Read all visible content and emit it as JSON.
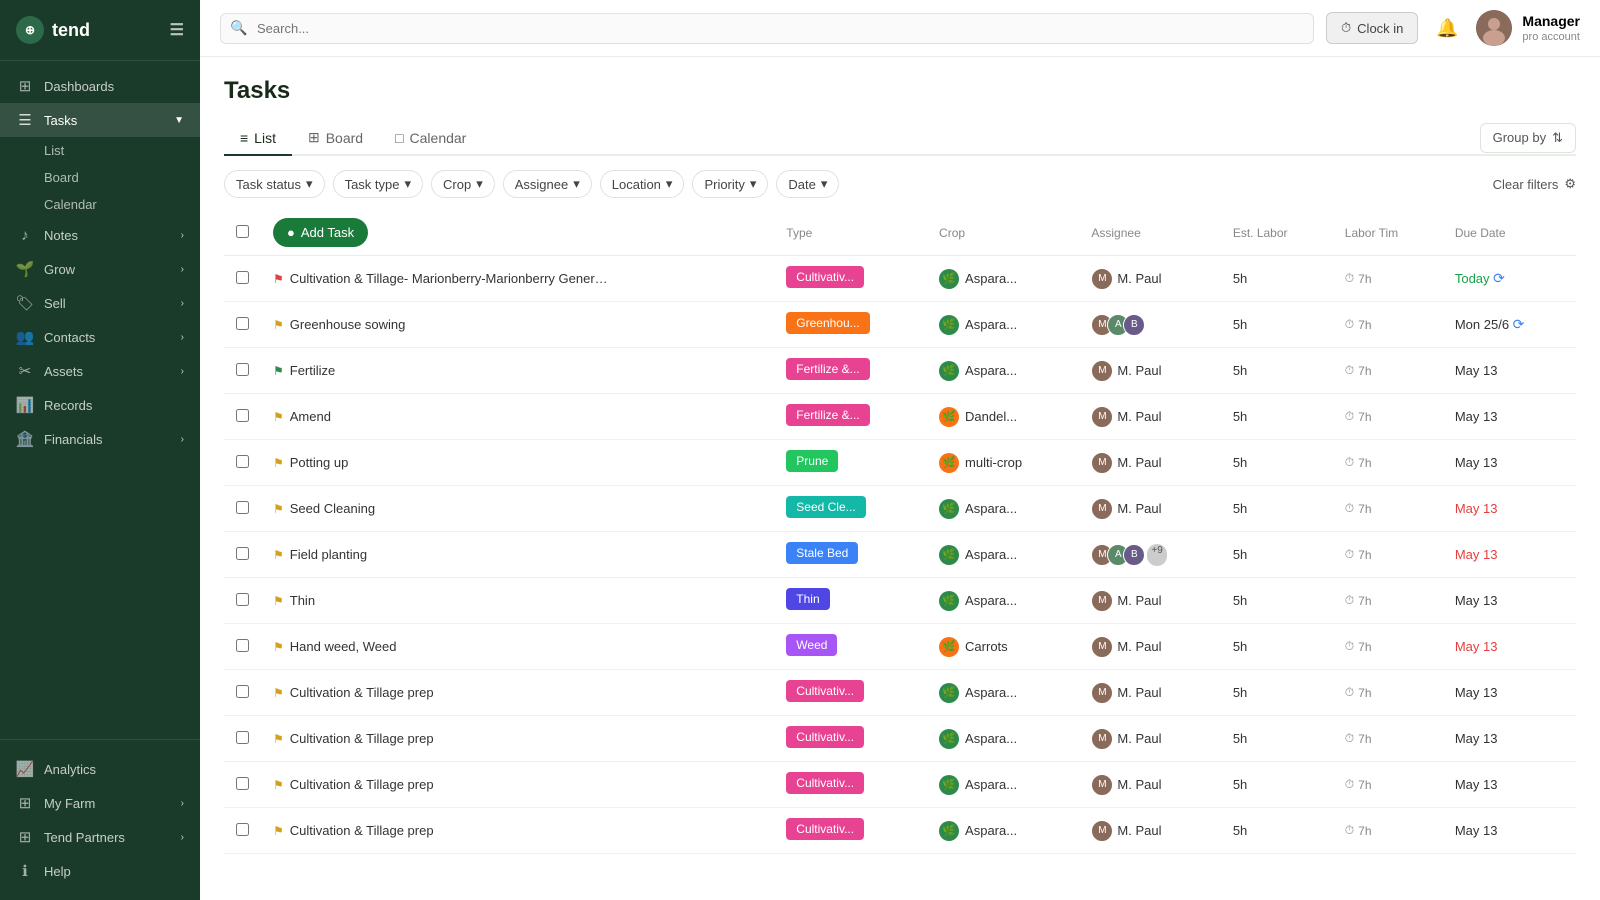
{
  "sidebar": {
    "logo_text": "tend",
    "nav_items": [
      {
        "id": "dashboards",
        "label": "Dashboards",
        "icon": "⊞",
        "active": false
      },
      {
        "id": "tasks",
        "label": "Tasks",
        "icon": "☰",
        "active": true,
        "expanded": true
      },
      {
        "id": "notes",
        "label": "Notes",
        "icon": "♪",
        "active": false,
        "has_arrow": true
      },
      {
        "id": "grow",
        "label": "Grow",
        "icon": "🌱",
        "active": false,
        "has_arrow": true
      },
      {
        "id": "sell",
        "label": "Sell",
        "icon": "🏷",
        "active": false,
        "has_arrow": true
      },
      {
        "id": "contacts",
        "label": "Contacts",
        "icon": "👥",
        "active": false,
        "has_arrow": true
      },
      {
        "id": "assets",
        "label": "Assets",
        "icon": "✂",
        "active": false,
        "has_arrow": true
      },
      {
        "id": "records",
        "label": "Records",
        "icon": "📊",
        "active": false
      },
      {
        "id": "financials",
        "label": "Financials",
        "icon": "🏦",
        "active": false,
        "has_arrow": true
      }
    ],
    "sub_nav": [
      "List",
      "Board",
      "Calendar"
    ],
    "bottom_items": [
      {
        "id": "analytics",
        "label": "Analytics",
        "icon": "📈"
      },
      {
        "id": "my-farm",
        "label": "My Farm",
        "icon": "⊞",
        "has_arrow": true
      },
      {
        "id": "tend-partners",
        "label": "Tend Partners",
        "icon": "⊞",
        "has_arrow": true
      },
      {
        "id": "help",
        "label": "Help",
        "icon": "ℹ"
      }
    ]
  },
  "topbar": {
    "search_placeholder": "Search...",
    "clock_btn_label": "Clock in",
    "user_name": "Manager",
    "user_role": "pro account"
  },
  "page": {
    "title": "Tasks",
    "view_tabs": [
      {
        "id": "list",
        "label": "List",
        "active": true,
        "icon": "≡"
      },
      {
        "id": "board",
        "label": "Board",
        "active": false,
        "icon": "⊞"
      },
      {
        "id": "calendar",
        "label": "Calendar",
        "active": false,
        "icon": "□"
      }
    ],
    "group_by_label": "Group by",
    "filters": [
      {
        "id": "task-status",
        "label": "Task status"
      },
      {
        "id": "task-type",
        "label": "Task type"
      },
      {
        "id": "crop",
        "label": "Crop"
      },
      {
        "id": "assignee",
        "label": "Assignee"
      },
      {
        "id": "location",
        "label": "Location"
      },
      {
        "id": "priority",
        "label": "Priority"
      },
      {
        "id": "date",
        "label": "Date"
      }
    ],
    "clear_filters_label": "Clear filters",
    "add_task_label": "Add Task",
    "table": {
      "columns": [
        "",
        "Type",
        "Crop",
        "Assignee",
        "Est. Labor",
        "Labor Tim",
        "Due Date"
      ],
      "rows": [
        {
          "id": 1,
          "name": "Cultivation & Tillage- Marionberry-Marionberry Generic - Ngu...",
          "flag": "red",
          "type_label": "Cultivativ...",
          "type_class": "type-cultivate",
          "crop": "Aspara...",
          "crop_color": "green",
          "assignee": "M. Paul",
          "est_labor": "5h",
          "labor_time": "7h",
          "due_date": "Today",
          "due_class": "date-today",
          "has_repeat": true,
          "multi_assignee": false
        },
        {
          "id": 2,
          "name": "Greenhouse sowing",
          "flag": "yellow",
          "type_label": "Greenhou...",
          "type_class": "type-greenhouse",
          "crop": "Aspara...",
          "crop_color": "green",
          "assignee": "multi",
          "est_labor": "5h",
          "labor_time": "7h",
          "due_date": "Mon 25/6",
          "due_class": "date-normal",
          "has_repeat": true,
          "multi_assignee": true
        },
        {
          "id": 3,
          "name": "Fertilize",
          "flag": "green",
          "type_label": "Fertilize &...",
          "type_class": "type-fertilize",
          "crop": "Aspara...",
          "crop_color": "green",
          "assignee": "M. Paul",
          "est_labor": "5h",
          "labor_time": "7h",
          "due_date": "May 13",
          "due_class": "date-normal",
          "has_repeat": false,
          "multi_assignee": false
        },
        {
          "id": 4,
          "name": "Amend",
          "flag": "yellow",
          "type_label": "Fertilize &...",
          "type_class": "type-fertilize",
          "crop": "Dandel...",
          "crop_color": "orange",
          "assignee": "M. Paul",
          "est_labor": "5h",
          "labor_time": "7h",
          "due_date": "May 13",
          "due_class": "date-normal",
          "has_repeat": false,
          "multi_assignee": false
        },
        {
          "id": 5,
          "name": "Potting up",
          "flag": "yellow",
          "type_label": "Prune",
          "type_class": "type-prune",
          "crop": "multi-crop",
          "crop_color": "orange",
          "assignee": "M. Paul",
          "est_labor": "5h",
          "labor_time": "7h",
          "due_date": "May 13",
          "due_class": "date-normal",
          "has_repeat": false,
          "multi_assignee": false
        },
        {
          "id": 6,
          "name": "Seed Cleaning",
          "flag": "yellow",
          "type_label": "Seed Cle...",
          "type_class": "type-seed-clean",
          "crop": "Aspara...",
          "crop_color": "green",
          "assignee": "M. Paul",
          "est_labor": "5h",
          "labor_time": "7h",
          "due_date": "May 13",
          "due_class": "date-overdue",
          "has_repeat": false,
          "multi_assignee": false
        },
        {
          "id": 7,
          "name": "Field planting",
          "flag": "yellow",
          "type_label": "Stale Bed",
          "type_class": "type-stale-bed",
          "crop": "Aspara...",
          "crop_color": "green",
          "assignee": "multi+9",
          "est_labor": "5h",
          "labor_time": "7h",
          "due_date": "May 13",
          "due_class": "date-overdue",
          "has_repeat": false,
          "multi_assignee": true,
          "extra_count": "+9"
        },
        {
          "id": 8,
          "name": "Thin",
          "flag": "yellow",
          "type_label": "Thin",
          "type_class": "type-thin",
          "crop": "Aspara...",
          "crop_color": "green",
          "assignee": "M. Paul",
          "est_labor": "5h",
          "labor_time": "7h",
          "due_date": "May 13",
          "due_class": "date-normal",
          "has_repeat": false,
          "multi_assignee": false
        },
        {
          "id": 9,
          "name": "Hand weed, Weed",
          "flag": "yellow",
          "type_label": "Weed",
          "type_class": "type-weed",
          "crop": "Carrots",
          "crop_color": "orange",
          "assignee": "M. Paul",
          "est_labor": "5h",
          "labor_time": "7h",
          "due_date": "May 13",
          "due_class": "date-overdue",
          "has_repeat": false,
          "multi_assignee": false
        },
        {
          "id": 10,
          "name": "Cultivation & Tillage prep",
          "flag": "yellow",
          "type_label": "Cultivativ...",
          "type_class": "type-cultivate",
          "crop": "Aspara...",
          "crop_color": "green",
          "assignee": "M. Paul",
          "est_labor": "5h",
          "labor_time": "7h",
          "due_date": "May 13",
          "due_class": "date-normal",
          "has_repeat": false,
          "multi_assignee": false
        },
        {
          "id": 11,
          "name": "Cultivation & Tillage prep",
          "flag": "yellow",
          "type_label": "Cultivativ...",
          "type_class": "type-cultivate",
          "crop": "Aspara...",
          "crop_color": "green",
          "assignee": "M. Paul",
          "est_labor": "5h",
          "labor_time": "7h",
          "due_date": "May 13",
          "due_class": "date-normal",
          "has_repeat": false,
          "multi_assignee": false
        },
        {
          "id": 12,
          "name": "Cultivation & Tillage prep",
          "flag": "yellow",
          "type_label": "Cultivativ...",
          "type_class": "type-cultivate",
          "crop": "Aspara...",
          "crop_color": "green",
          "assignee": "M. Paul",
          "est_labor": "5h",
          "labor_time": "7h",
          "due_date": "May 13",
          "due_class": "date-normal",
          "has_repeat": false,
          "multi_assignee": false
        },
        {
          "id": 13,
          "name": "Cultivation & Tillage prep",
          "flag": "yellow",
          "type_label": "Cultivativ...",
          "type_class": "type-cultivate",
          "crop": "Aspara...",
          "crop_color": "green",
          "assignee": "M. Paul",
          "est_labor": "5h",
          "labor_time": "7h",
          "due_date": "May 13",
          "due_class": "date-normal",
          "has_repeat": false,
          "multi_assignee": false
        }
      ]
    }
  }
}
